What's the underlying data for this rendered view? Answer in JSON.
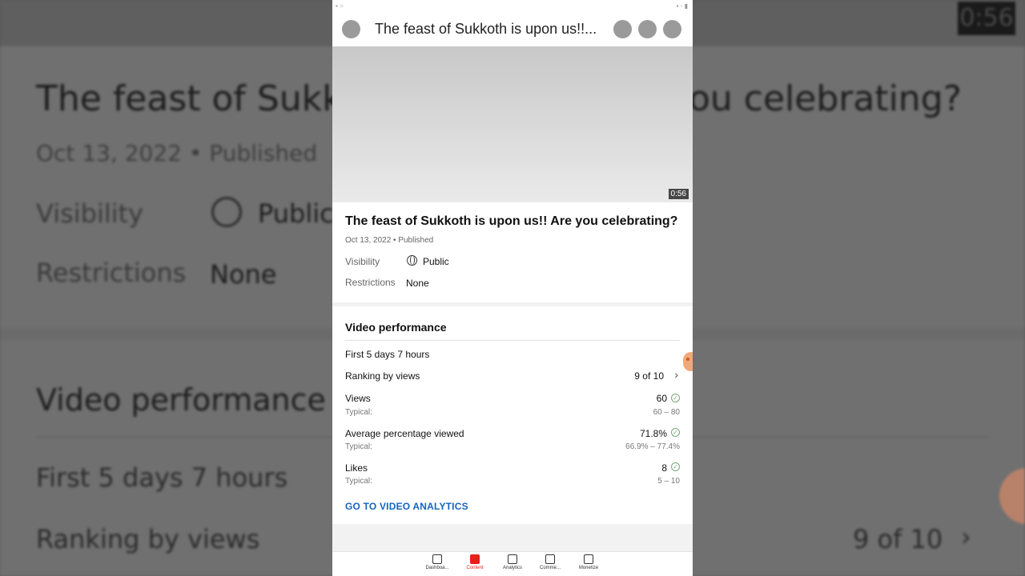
{
  "background": {
    "title_left": "The feast of Sukk",
    "title_right": "ou celebrating?",
    "date": "Oct 13, 2022 • Published",
    "visibility_label": "Visibility",
    "visibility_value": "Public",
    "restrictions_label": "Restrictions",
    "restrictions_value": "None",
    "perf_title": "Video performance",
    "period": "First 5 days 7 hours",
    "ranking_label": "Ranking by views",
    "ranking_value": "9 of 10",
    "chevron": "›",
    "timer": "0:56"
  },
  "appbar": {
    "title": "The feast of Sukkoth is upon us!!..."
  },
  "video": {
    "duration": "0:56"
  },
  "details": {
    "title": "The feast of Sukkoth is upon us!! Are you celebrating?",
    "date_status": "Oct 13, 2022 • Published",
    "visibility_label": "Visibility",
    "visibility_value": "Public",
    "restrictions_label": "Restrictions",
    "restrictions_value": "None"
  },
  "performance": {
    "title": "Video performance",
    "period": "First 5 days 7 hours",
    "ranking_label": "Ranking by views",
    "ranking_value": "9 of 10",
    "chevron": "›",
    "metrics": [
      {
        "label": "Views",
        "value": "60",
        "typical_label": "Typical:",
        "typical": "60 – 80",
        "check": "✓"
      },
      {
        "label": "Average percentage viewed",
        "value": "71.8%",
        "typical_label": "Typical:",
        "typical": "66.9% – 77.4%",
        "check": "✓"
      },
      {
        "label": "Likes",
        "value": "8",
        "typical_label": "Typical:",
        "typical": "5 – 10",
        "check": "✓"
      }
    ],
    "analytics_link": "GO TO VIDEO ANALYTICS"
  },
  "bottom_nav": {
    "items": [
      {
        "label": "Dashboa...",
        "icon": "dashboard-icon"
      },
      {
        "label": "Content",
        "icon": "content-icon",
        "active": true
      },
      {
        "label": "Analytics",
        "icon": "analytics-icon"
      },
      {
        "label": "Comme...",
        "icon": "comments-icon"
      },
      {
        "label": "Monetize",
        "icon": "monetize-icon"
      }
    ]
  },
  "colors": {
    "accent": "#e62117",
    "link": "#1565c0"
  }
}
